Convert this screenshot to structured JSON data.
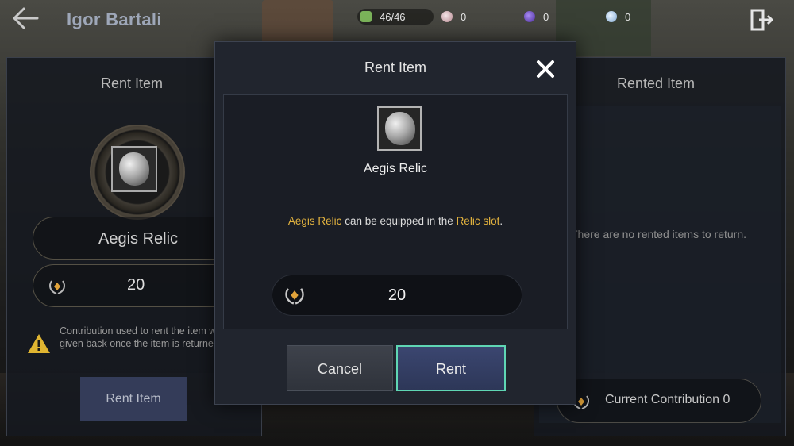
{
  "topbar": {
    "title": "Igor Bartali",
    "energy": "46/46",
    "pearl_count": "0",
    "orb_count": "0",
    "crystal_count": "0"
  },
  "left_panel": {
    "title": "Rent Item",
    "item_name": "Aegis Relic",
    "cost": "20",
    "warning": "Contribution used to rent the item will be given back once the item is returned.",
    "rent_button": "Rent Item"
  },
  "right_panel": {
    "title": "Rented Item",
    "empty_message": "There are no rented items to return.",
    "contribution_label": "Current Contribution 0"
  },
  "modal": {
    "title": "Rent Item",
    "item_name": "Aegis Relic",
    "desc_item": "Aegis Relic",
    "desc_mid": " can be equipped in the ",
    "desc_slot": "Relic slot",
    "desc_end": ".",
    "cost": "20",
    "cancel_label": "Cancel",
    "rent_label": "Rent"
  },
  "colors": {
    "accent_gold": "#e2b23e",
    "rent_border": "#5fd6b4",
    "rent_button": "#2d3758",
    "warning": "#e0b531"
  },
  "icons": {
    "back": "arrow-left-icon",
    "exit": "exit-door-icon",
    "close": "close-x-icon",
    "contribution": "laurel-medal-icon",
    "warning": "warning-triangle-icon",
    "relic": "stone-relic-icon"
  }
}
